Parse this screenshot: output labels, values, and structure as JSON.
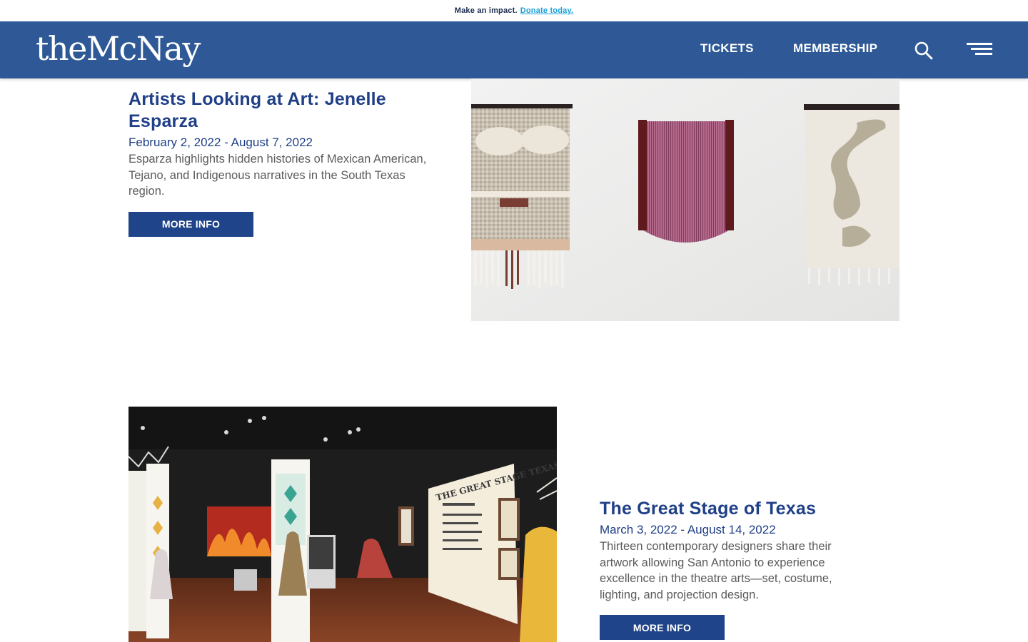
{
  "announcement": {
    "text": "Make an impact.",
    "link": "Donate today."
  },
  "header": {
    "logo": "theMcNay",
    "nav": {
      "tickets": "TICKETS",
      "membership": "MEMBERSHIP"
    },
    "icons": {
      "search": "search-icon",
      "menu": "hamburger-menu-icon"
    }
  },
  "exhibitions": [
    {
      "title": "Artists Looking at Art: Jenelle Esparza",
      "dates": "February 2, 2022 - August 7, 2022",
      "description": "Esparza highlights hidden histories of Mexican American, Tejano, and Indigenous narratives in the South Texas region.",
      "button": "MORE INFO"
    },
    {
      "title": "The Great Stage of Texas",
      "dates": "March 3, 2022 - August 14, 2022",
      "description": "Thirteen contemporary designers share their artwork allowing San Antonio to experience excellence in the theatre arts—set, costume, lighting, and projection design.",
      "button": "MORE INFO",
      "poster_text": "THE GREAT STAGE TEXAS"
    }
  ],
  "colors": {
    "header_bg": "#2e5896",
    "title": "#1f3f87",
    "button_bg": "#1f4489",
    "link": "#19a0d8"
  }
}
